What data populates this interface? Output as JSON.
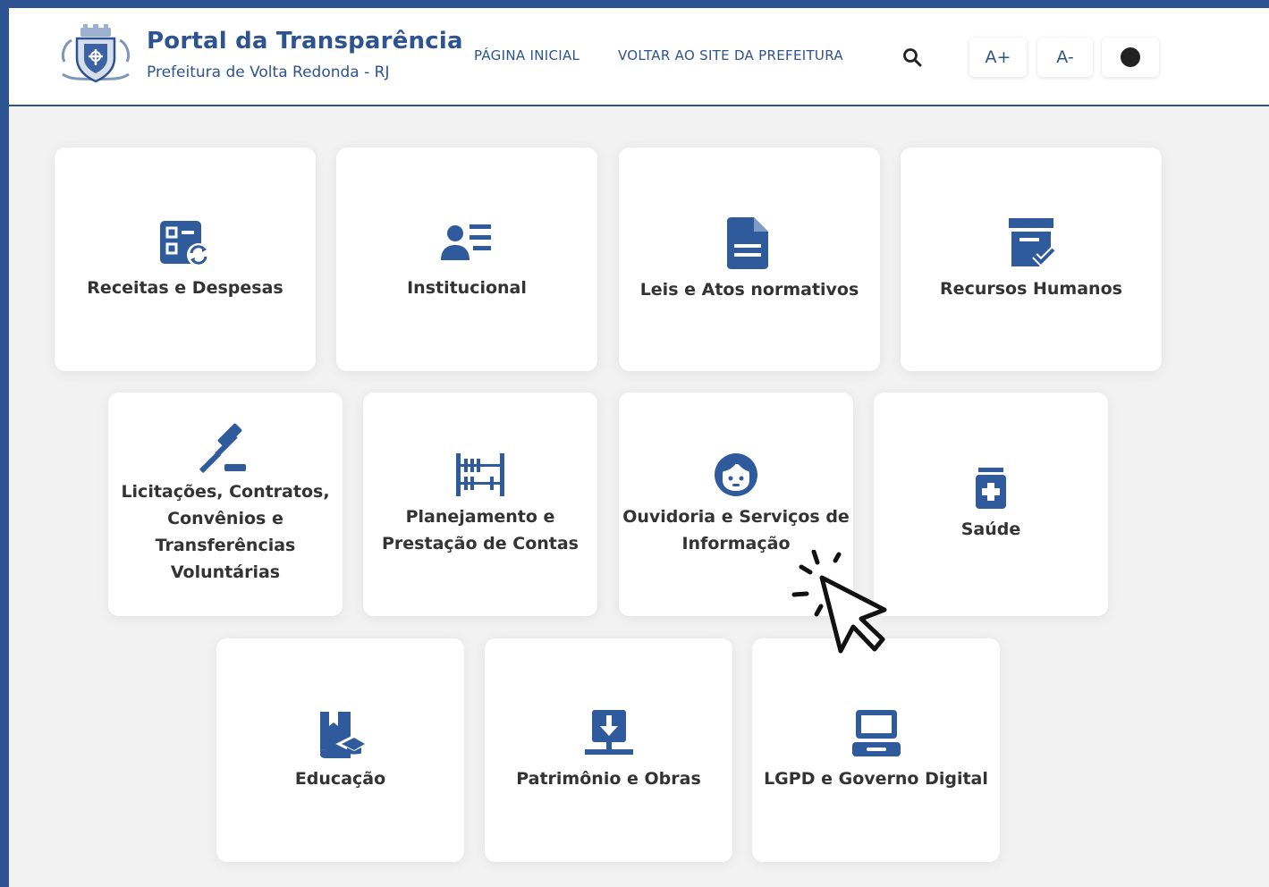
{
  "header": {
    "title": "Portal da Transparência",
    "subtitle": "Prefeitura de Volta Redonda - RJ",
    "nav": [
      {
        "label": "PÁGINA INICIAL"
      },
      {
        "label": "VOLTAR AO SITE DA PREFEITURA"
      }
    ],
    "search_icon": "search-icon",
    "font_increase_label": "A+",
    "font_decrease_label": "A-",
    "contrast_icon": "contrast-icon"
  },
  "cards": [
    {
      "label": "Receitas e Despesas",
      "icon": "finance-sync-icon"
    },
    {
      "label": "Institucional",
      "icon": "person-list-icon"
    },
    {
      "label": "Leis e Atos normativos",
      "icon": "document-icon"
    },
    {
      "label": "Recursos Humanos",
      "icon": "archive-check-icon"
    },
    {
      "label": "Licitações, Contratos,\nConvênios e\nTransferências\nVoluntárias",
      "icon": "gavel-icon"
    },
    {
      "label": "Planejamento e\nPrestação de Contas",
      "icon": "abacus-icon"
    },
    {
      "label": "Ouvidoria e Serviços de\nInformação",
      "icon": "headset-icon"
    },
    {
      "label": "Saúde",
      "icon": "medicine-icon"
    },
    {
      "label": "Educação",
      "icon": "book-graduation-icon"
    },
    {
      "label": "Patrimônio e Obras",
      "icon": "download-building-icon"
    },
    {
      "label": "LGPD e Governo Digital",
      "icon": "laptop-icon"
    }
  ],
  "colors": {
    "accent": "#2e5391",
    "icon": "#2f5b9c",
    "card_text": "#333333",
    "background": "#f2f2f2"
  }
}
